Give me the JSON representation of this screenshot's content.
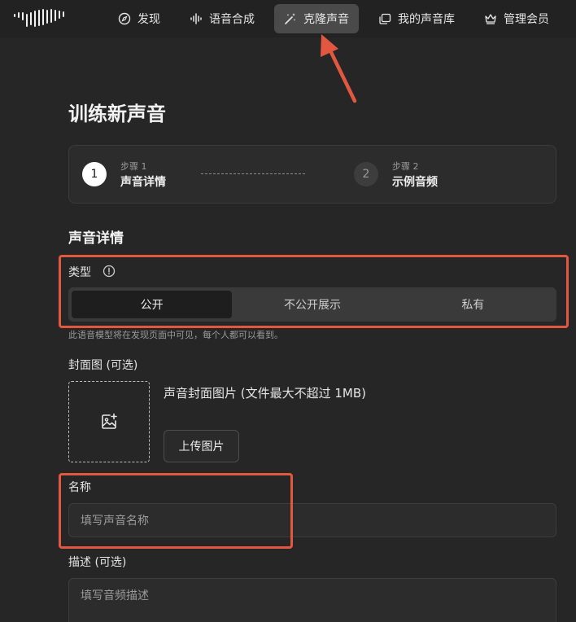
{
  "nav": {
    "items": [
      {
        "label": "发现",
        "icon": "compass-icon"
      },
      {
        "label": "语音合成",
        "icon": "waveform-icon"
      },
      {
        "label": "克隆声音",
        "icon": "magic-wand-icon",
        "active": true
      },
      {
        "label": "我的声音库",
        "icon": "library-icon"
      },
      {
        "label": "管理会员",
        "icon": "crown-icon"
      }
    ]
  },
  "page": {
    "title": "训练新声音"
  },
  "steps": [
    {
      "number": "1",
      "kicker": "步骤 1",
      "label": "声音详情",
      "active": true
    },
    {
      "number": "2",
      "kicker": "步骤 2",
      "label": "示例音频",
      "active": false
    }
  ],
  "form": {
    "section_title": "声音详情",
    "type": {
      "label": "类型",
      "options": [
        "公开",
        "不公开展示",
        "私有"
      ],
      "selected": "公开",
      "hint": "此语音模型将在发现页面中可见，每个人都可以看到。"
    },
    "cover": {
      "label": "封面图 (可选)",
      "description": "声音封面图片 (文件最大不超过 1MB)",
      "upload_label": "上传图片"
    },
    "name": {
      "label": "名称",
      "placeholder": "填写声音名称"
    },
    "description": {
      "label": "描述 (可选)",
      "placeholder": "填写音频描述"
    }
  },
  "colors": {
    "background": "#262626",
    "highlight": "#e2573f",
    "active_tab": "#4a4a4a"
  }
}
